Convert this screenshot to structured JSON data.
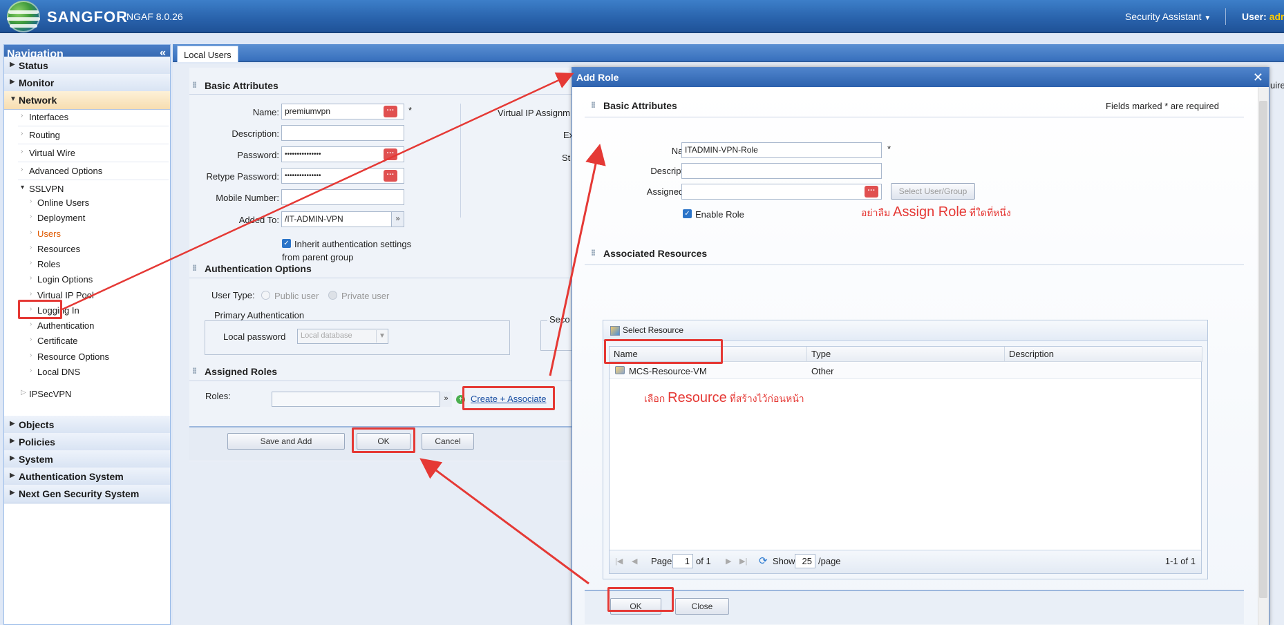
{
  "header": {
    "brand": "SANGFOR",
    "product": "NGAF 8.0.26",
    "security_assistant": "Security Assistant",
    "user_label": "User:",
    "user_name": "adm"
  },
  "nav": {
    "title": "Navigation",
    "collapse": "«",
    "top_sections": [
      "Status",
      "Monitor",
      "Network"
    ],
    "network_items": [
      "Interfaces",
      "Routing",
      "Virtual Wire",
      "Advanced Options",
      "SSLVPN"
    ],
    "sslvpn_items": [
      "Online Users",
      "Deployment",
      "Users",
      "Resources",
      "Roles",
      "Login Options",
      "Virtual IP Pool",
      "Logging In",
      "Authentication",
      "Certificate",
      "Resource Options",
      "Local DNS"
    ],
    "ipsec": "IPSecVPN",
    "bottom_sections": [
      "Objects",
      "Policies",
      "System",
      "Authentication System",
      "Next Gen Security System"
    ],
    "active_item": "Users"
  },
  "tab": {
    "label": "Local Users"
  },
  "user_form": {
    "basic_title": "Basic Attributes",
    "name_label": "Name:",
    "name_value": "premiumvpn",
    "desc_label": "Description:",
    "password_label": "Password:",
    "password_value": "•••••••••••••••",
    "retype_label": "Retype Password:",
    "retype_value": "•••••••••••••••",
    "mobile_label": "Mobile Number:",
    "added_label": "Added To:",
    "added_value": "/IT-ADMIN-VPN",
    "inherit_label": "Inherit authentication settings",
    "inherit_label2": "from parent group",
    "vip_label": "Virtual IP Assignm",
    "ex_label": "Ex",
    "st_label": "St",
    "auth_title": "Authentication Options",
    "user_type_label": "User Type:",
    "public_user": "Public user",
    "private_user": "Private user",
    "primary_auth": "Primary Authentication",
    "local_pw_label": "Local password",
    "local_db": "Local database",
    "seco": "Seco",
    "roles_title": "Assigned Roles",
    "roles_label": "Roles:",
    "create_link": "Create + Associate",
    "save_add": "Save and Add",
    "ok": "OK",
    "cancel": "Cancel",
    "required_star": "*",
    "right_cut": "uire"
  },
  "dialog": {
    "title": "Add Role",
    "close": "✕",
    "basic_title": "Basic Attributes",
    "required_note": "Fields marked * are required",
    "name_label": "Name:",
    "name_value": "ITADMIN-VPN-Role",
    "desc_label": "Description:",
    "assigned_label": "Assigned To:",
    "select_user_btn": "Select User/Group",
    "enable_role": "Enable Role",
    "note_assign_pre": "อย่าลืม",
    "note_assign_big": "Assign Role",
    "note_assign_post": "ที่ใดที่หนึ่ง",
    "resources_title": "Associated Resources",
    "select_resource": "Select Resource",
    "columns": [
      "Name",
      "Type",
      "Description"
    ],
    "rows": [
      {
        "name": "MCS-Resource-VM",
        "type": "Other",
        "description": ""
      }
    ],
    "note_res_pre": "เลือก",
    "note_res_big": "Resource",
    "note_res_post": "ที่สร้างไว้ก่อนหน้า",
    "pager": {
      "page_label": "Page",
      "page": "1",
      "of": "of 1",
      "show": "Show",
      "per_page": "25",
      "per_page_unit": "/page",
      "summary": "1-1 of 1"
    },
    "ok": "OK",
    "close_btn": "Close",
    "required_star": "*"
  },
  "colors": {
    "annotation_red": "#e53935",
    "header_blue": "#2a64ad",
    "active_orange": "#e05a00"
  }
}
